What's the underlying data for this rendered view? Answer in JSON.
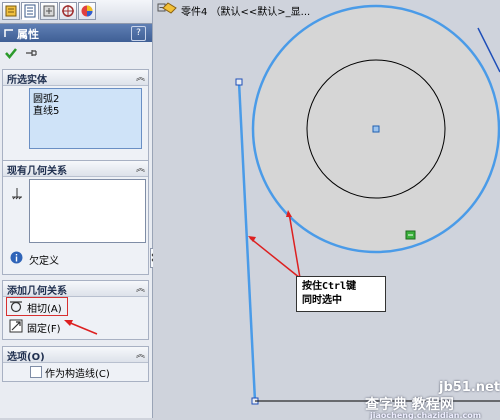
{
  "property_manager": {
    "tabs": [
      "feature-manager-icon",
      "property-manager-icon",
      "configuration-manager-icon",
      "dimxpert-icon",
      "display-manager-icon"
    ],
    "title": "属性",
    "help_label": "?",
    "selected_entities": {
      "title": "所选实体",
      "items": [
        "圆弧2",
        "直线5"
      ]
    },
    "existing_relations": {
      "title": "现有几何关系",
      "status": "欠定义"
    },
    "add_relations": {
      "title": "添加几何关系",
      "items": [
        "相切(A)",
        "固定(F)"
      ]
    },
    "options": {
      "title": "选项(O)",
      "construction_label": "作为构造线(C)",
      "construction_checked": false
    }
  },
  "graphics": {
    "tree_label": "零件4 （默认<<默认>_显...",
    "callout_lines": [
      "按住Ctrl键",
      "同时选中"
    ]
  },
  "watermark": {
    "line1": "jb51.net",
    "line2": "查字典 教程网",
    "line3": "jiaocheng.chazidian.com"
  },
  "colors": {
    "highlight": "#4a9be8",
    "arrow": "#dd2020",
    "sketch": "#000000",
    "disc_fill": "#d6d6d6",
    "canvas": "#cfd3dc"
  }
}
